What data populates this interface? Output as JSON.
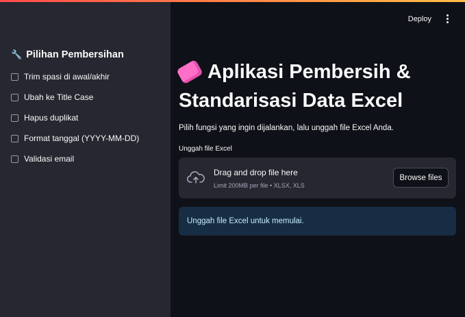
{
  "header": {
    "deploy_label": "Deploy",
    "menu_icon": "kebab-menu-icon",
    "accent_gradient": [
      "#ff4b4b",
      "#ffbd45"
    ]
  },
  "sidebar": {
    "title_icon": "wrench-icon",
    "title": "Pilihan Pembersihan",
    "options": [
      {
        "label": "Trim spasi di awal/akhir",
        "checked": false
      },
      {
        "label": "Ubah ke Title Case",
        "checked": false
      },
      {
        "label": "Hapus duplikat",
        "checked": false
      },
      {
        "label": "Format tanggal (YYYY-MM-DD)",
        "checked": false
      },
      {
        "label": "Validasi email",
        "checked": false
      }
    ]
  },
  "main": {
    "title_icon": "soap-icon",
    "title": "Aplikasi Pembersih & Standarisasi Data Excel",
    "description": "Pilih fungsi yang ingin dijalankan, lalu unggah file Excel Anda.",
    "uploader": {
      "label": "Unggah file Excel",
      "icon": "cloud-upload-icon",
      "drop_text": "Drag and drop file here",
      "limit_text": "Limit 200MB per file • XLSX, XLS",
      "browse_label": "Browse files"
    },
    "info_message": "Unggah file Excel untuk memulai."
  }
}
